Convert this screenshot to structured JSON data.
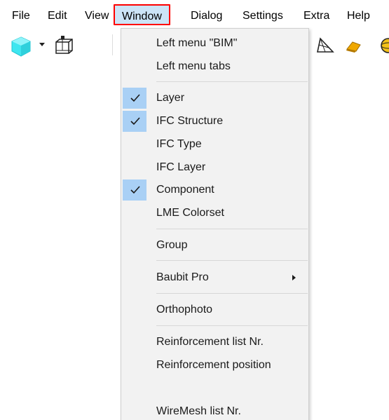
{
  "menubar": {
    "items": [
      {
        "label": "File"
      },
      {
        "label": "Edit"
      },
      {
        "label": "View"
      },
      {
        "label": "Window"
      },
      {
        "label": "Dialog"
      },
      {
        "label": "Settings"
      },
      {
        "label": "Extra"
      },
      {
        "label": "Help"
      }
    ],
    "active_index": 3,
    "highlight_color": "#ff0000"
  },
  "toolbar": {
    "icons": [
      "cube-icon",
      "dropdown-arrow-icon",
      "box-frame-icon",
      "wireframe-triangle-icon",
      "eraser-icon",
      "sphere-icon"
    ]
  },
  "window_menu": {
    "items": [
      {
        "label": "Left menu \"BIM\"",
        "checked": false
      },
      {
        "label": "Left menu tabs",
        "checked": false
      },
      {
        "label": "Layer",
        "checked": true
      },
      {
        "label": "IFC Structure",
        "checked": true
      },
      {
        "label": "IFC Type",
        "checked": false
      },
      {
        "label": "IFC Layer",
        "checked": false
      },
      {
        "label": "Component",
        "checked": true
      },
      {
        "label": "LME Colorset",
        "checked": false
      },
      {
        "label": "Group",
        "checked": false
      },
      {
        "label": "Baubit Pro",
        "checked": false,
        "submenu": true
      },
      {
        "label": "Orthophoto",
        "checked": false
      },
      {
        "label": "Reinforcement list Nr.",
        "checked": false
      },
      {
        "label": "Reinforcement position",
        "checked": false
      },
      {
        "label": "WireMesh list Nr.",
        "checked": false
      }
    ],
    "check_color": "#a9d0f5"
  }
}
